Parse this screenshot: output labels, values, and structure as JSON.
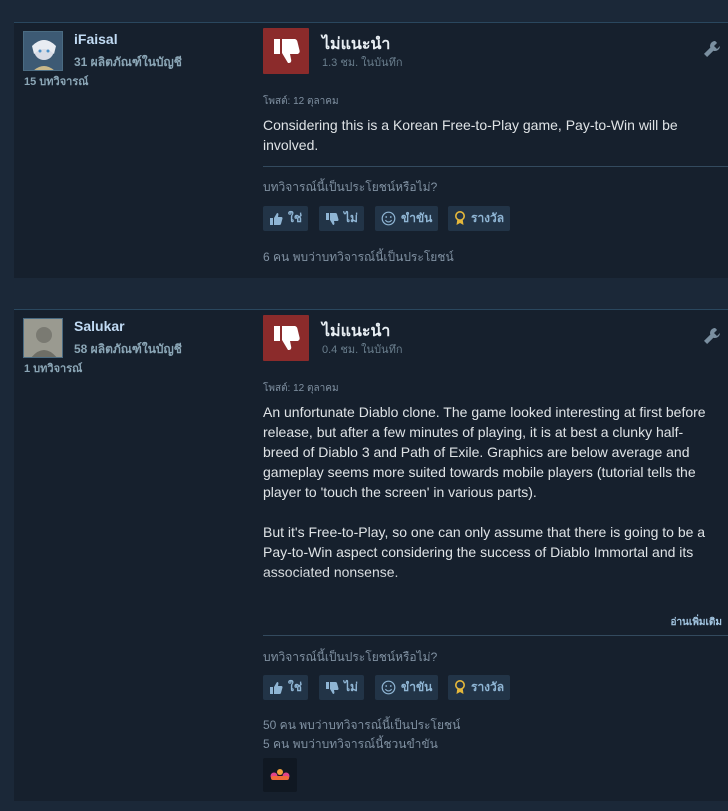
{
  "reviews": [
    {
      "user": {
        "name": "iFaisal",
        "products_owned": "31 ผลิตภัณฑ์ในบัญชี",
        "review_count": "15 บทวิจารณ์"
      },
      "verdict": "ไม่แนะนำ",
      "hours": "1.3 ชม. ในบันทึก",
      "posted": "โพสต์: 12 ตุลาคม",
      "body": "Considering this is a Korean Free-to-Play game, Pay-to-Win will be involved.",
      "helpful_question": "บทวิจารณ์นี้เป็นประโยชน์หรือไม่?",
      "buttons": {
        "yes": "ใช่",
        "no": "ไม่",
        "funny": "ขำขัน",
        "award": "รางวัล"
      },
      "found_helpful": "6 คน พบว่าบทวิจารณ์นี้เป็นประโยชน์"
    },
    {
      "user": {
        "name": "Salukar",
        "products_owned": "58 ผลิตภัณฑ์ในบัญชี",
        "review_count": "1 บทวิจารณ์"
      },
      "verdict": "ไม่แนะนำ",
      "hours": "0.4 ชม. ในบันทึก",
      "posted": "โพสต์: 12 ตุลาคม",
      "body_paragraphs": [
        "An unfortunate Diablo clone. The game looked interesting at first before release, but after a few minutes of playing, it is at best a clunky half-breed of Diablo 3 and Path of Exile. Graphics are below average and gameplay seems more suited towards mobile players (tutorial tells the player to 'touch the screen' in various parts).",
        "But it's Free-to-Play, so one can only assume that there is going to be a Pay-to-Win aspect considering the success of Diablo Immortal and its associated nonsense."
      ],
      "read_more": "อ่านเพิ่มเติม",
      "helpful_question": "บทวิจารณ์นี้เป็นประโยชน์หรือไม่?",
      "buttons": {
        "yes": "ใช่",
        "no": "ไม่",
        "funny": "ขำขัน",
        "award": "รางวัล"
      },
      "found_helpful": "50 คน พบว่าบทวิจารณ์นี้เป็นประโยชน์",
      "found_funny": "5 คน พบว่าบทวิจารณ์นี้ชวนขำขัน"
    }
  ],
  "colors": {
    "background": "#1b2838",
    "card": "#16202d",
    "thumbs_down": "#8b2b2b",
    "button": "#223447",
    "link": "#a4c7e3"
  }
}
